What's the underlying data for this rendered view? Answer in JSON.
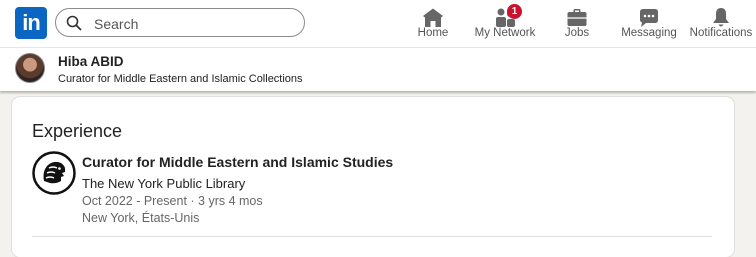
{
  "nav": {
    "logo_text": "in",
    "search": {
      "placeholder": "Search",
      "value": ""
    },
    "items": [
      {
        "label": "Home",
        "icon": "home-icon"
      },
      {
        "label": "My Network",
        "icon": "network-icon",
        "badge": "1"
      },
      {
        "label": "Jobs",
        "icon": "briefcase-icon"
      },
      {
        "label": "Messaging",
        "icon": "messaging-icon"
      },
      {
        "label": "Notifications",
        "icon": "bell-icon"
      }
    ],
    "colors": {
      "brand": "#0a66c2",
      "badge": "#cb112d"
    }
  },
  "profile": {
    "name": "Hiba ABID",
    "headline": "Curator for Middle Eastern and Islamic Collections"
  },
  "experience": {
    "title": "Experience",
    "entries": [
      {
        "role": "Curator for Middle Eastern and Islamic Studies",
        "company": "The New York Public Library",
        "dates": "Oct 2022 - Present · 3 yrs 4 mos",
        "location": "New York, États-Unis",
        "logo": "nypl-lion-logo"
      }
    ]
  }
}
